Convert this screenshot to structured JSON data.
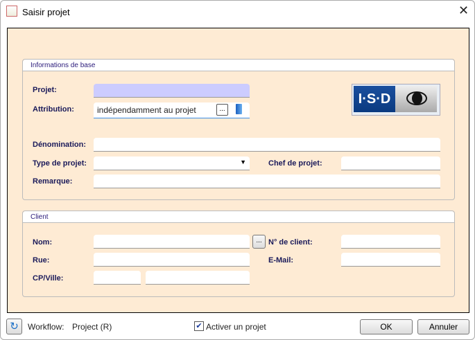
{
  "window": {
    "title": "Saisir projet"
  },
  "basic": {
    "header": "Informations de base",
    "projet_label": "Projet:",
    "projet_value": "",
    "attribution_label": "Attribution:",
    "attribution_value": "indépendamment au projet",
    "browse": "...",
    "denomination_label": "Dénomination:",
    "type_label": "Type de projet:",
    "chef_label": "Chef de projet:",
    "remarque_label": "Remarque:",
    "logo_text": "I·S·D"
  },
  "client": {
    "header": "Client",
    "nom_label": "Nom:",
    "browse": "...",
    "numero_label": "N° de client:",
    "rue_label": "Rue:",
    "email_label": "E-Mail:",
    "cp_label": "CP/Ville:"
  },
  "footer": {
    "workflow_label": "Workflow:",
    "workflow_value": "Project (R)",
    "activate_label": "Activer un projet",
    "activate_checked": true,
    "ok": "OK",
    "cancel": "Annuler"
  }
}
